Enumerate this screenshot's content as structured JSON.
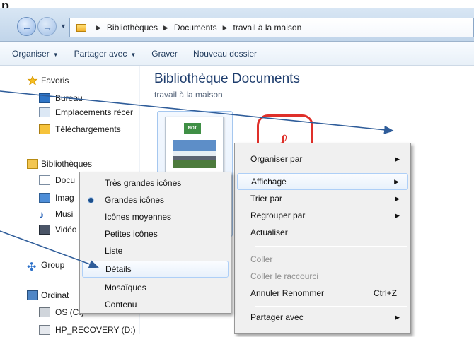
{
  "top_label": "p",
  "address": {
    "crumbs": [
      "Bibliothèques",
      "Documents",
      "travail à la maison"
    ]
  },
  "toolbar": {
    "buttons": [
      "Organiser",
      "Partager avec",
      "Graver",
      "Nouveau dossier"
    ]
  },
  "nav": {
    "favorites": "Favoris",
    "desktop": "Bureau",
    "recent": "Emplacements récer",
    "downloads": "Téléchargements",
    "libraries": "Bibliothèques",
    "documents": "Docu",
    "images": "Imag",
    "music": "Musi",
    "videos": "Vidéo",
    "group": "Group",
    "computer": "Ordinat",
    "os": "OS (C:)",
    "recovery": "HP_RECOVERY (D:)"
  },
  "main": {
    "title": "Bibliothèque Documents",
    "subtitle": "travail à la maison",
    "thumb_header": "NOT"
  },
  "view_menu": {
    "items": [
      "Très grandes icônes",
      "Grandes icônes",
      "Icônes moyennes",
      "Petites icônes",
      "Liste",
      "Détails",
      "Mosaïques",
      "Contenu"
    ],
    "selected": "Grandes icônes",
    "highlighted": "Détails"
  },
  "context_menu": {
    "organize": "Organiser par",
    "view": "Affichage",
    "sort": "Trier par",
    "group": "Regrouper par",
    "refresh": "Actualiser",
    "paste": "Coller",
    "paste_shortcut": "Coller le raccourci",
    "undo": "Annuler Renommer",
    "undo_shortcut": "Ctrl+Z",
    "share": "Partager avec"
  },
  "colors": {
    "title_blue": "#1e3d6d",
    "selection_blue": "#aecff7",
    "arrow_blue": "#2f5d9a"
  }
}
